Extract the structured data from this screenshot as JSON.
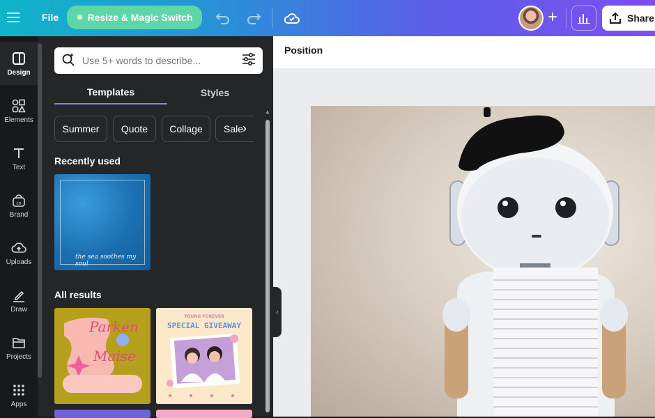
{
  "topbar": {
    "file_label": "File",
    "resize_label": "Resize & Magic Switch",
    "share_label": "Share",
    "icons": [
      "hamburger-icon",
      "undo-icon",
      "redo-icon",
      "cloud-check-icon",
      "plus-icon",
      "bar-chart-icon",
      "upload-icon"
    ]
  },
  "rail": {
    "items": [
      {
        "label": "Design",
        "icon": "design-icon"
      },
      {
        "label": "Elements",
        "icon": "elements-icon"
      },
      {
        "label": "Text",
        "icon": "text-icon"
      },
      {
        "label": "Brand",
        "icon": "brand-icon"
      },
      {
        "label": "Uploads",
        "icon": "uploads-icon"
      },
      {
        "label": "Draw",
        "icon": "draw-icon"
      },
      {
        "label": "Projects",
        "icon": "folder-icon"
      },
      {
        "label": "Apps",
        "icon": "apps-icon"
      }
    ]
  },
  "panel": {
    "search_placeholder": "Use 5+ words to describe...",
    "tabs": [
      "Templates",
      "Styles"
    ],
    "chips": [
      "Summer",
      "Quote",
      "Collage",
      "Sale"
    ],
    "recently_used": "Recently used",
    "all_results": "All results",
    "recent_thumb_text": "the sea soothes my soul",
    "thumb1": {
      "line1": "Parken",
      "line2": "Maise"
    },
    "thumb2": {
      "header": "YOUNG FOREVER",
      "title": "SPECIAL GIVEAWAY"
    }
  },
  "context": {
    "position_label": "Position"
  },
  "colors": {
    "accent": "#8b7cf6",
    "resize_button": "#5dd6a8",
    "panel_bg": "#252627",
    "rail_bg": "#18191b",
    "canvas_bg": "#ebecf0"
  }
}
